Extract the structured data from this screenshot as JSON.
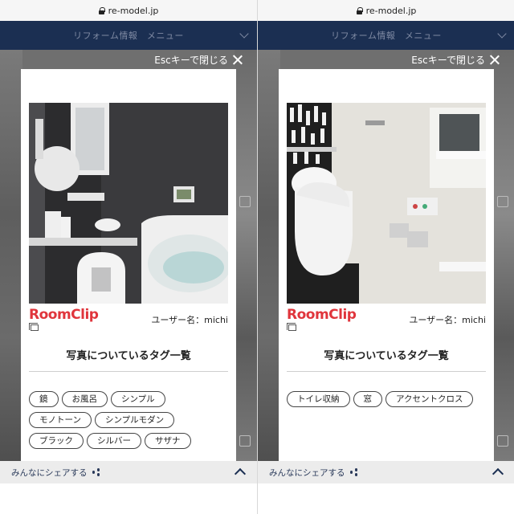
{
  "panes": [
    {
      "url": "re-model.jp",
      "header_label": "リフォーム情報　メニュー",
      "close_label": "Escキーで閉じる",
      "brand": "RoomClip",
      "username": "ユーザー名：michi",
      "tags_title": "写真についているタグ一覧",
      "tags": [
        "鏡",
        "お風呂",
        "シンプル",
        "モノトーン",
        "シンプルモダン",
        "ブラック",
        "シルバー",
        "サザナ"
      ],
      "share_label": "みんなにシェアする"
    },
    {
      "url": "re-model.jp",
      "header_label": "リフォーム情報　メニュー",
      "close_label": "Escキーで閉じる",
      "brand": "RoomClip",
      "username": "ユーザー名：michi",
      "tags_title": "写真についているタグ一覧",
      "tags": [
        "トイレ収納",
        "窓",
        "アクセントクロス"
      ],
      "share_label": "みんなにシェアする"
    }
  ],
  "colors": {
    "header_bg": "#1b2f52",
    "brand_red": "#e0353c",
    "overlay": "#6f6f6f"
  },
  "icons": [
    "lock-icon",
    "chevron-down-icon",
    "close-icon",
    "photo-icon",
    "share-icon",
    "chevron-up-icon"
  ]
}
